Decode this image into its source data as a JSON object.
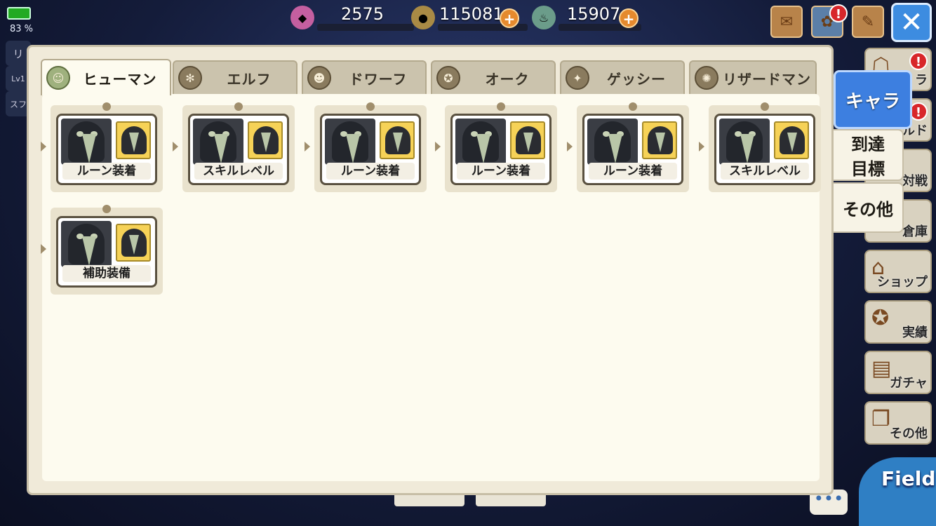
{
  "status": {
    "battery_pct": "83 %"
  },
  "hud_ghost": {
    "name_frag": "リ",
    "lv_frag": "Lv1",
    "sk_frag": "スフ"
  },
  "resources": [
    {
      "name": "crystal",
      "icon": "crystal-icon",
      "value": "2575",
      "has_plus": false
    },
    {
      "name": "gold",
      "icon": "coin-icon",
      "value": "115081",
      "has_plus": true
    },
    {
      "name": "potion",
      "icon": "potion-icon",
      "value": "15907",
      "has_plus": true
    }
  ],
  "top_buttons": [
    "mail-icon",
    "gift-icon",
    "quest-icon"
  ],
  "close_symbol": "✕",
  "tabs": [
    {
      "label": "ヒューマン",
      "active": true,
      "emblem": "☺"
    },
    {
      "label": "エルフ",
      "active": false,
      "emblem": "✻"
    },
    {
      "label": "ドワーフ",
      "active": false,
      "emblem": "☻"
    },
    {
      "label": "オーク",
      "active": false,
      "emblem": "✪"
    },
    {
      "label": "ゲッシー",
      "active": false,
      "emblem": "✦"
    },
    {
      "label": "リザードマン",
      "active": false,
      "emblem": "✺"
    }
  ],
  "nodes": [
    {
      "label": "ルーン装着"
    },
    {
      "label": "スキルレベル"
    },
    {
      "label": "ルーン装着"
    },
    {
      "label": "ルーン装着"
    },
    {
      "label": "ルーン装着"
    },
    {
      "label": "スキルレベル"
    },
    {
      "label": "補助装備"
    }
  ],
  "side_tabs": [
    {
      "label": "キャラ",
      "active": true
    },
    {
      "label": "到達\n目標",
      "active": false
    },
    {
      "label": "その他",
      "active": false
    }
  ],
  "right_menu": [
    {
      "label": "ラ",
      "icon": "character-icon",
      "alert": true
    },
    {
      "label": "ルド",
      "icon": "guild-icon",
      "alert": true
    },
    {
      "label": "対戦",
      "icon": "battle-icon",
      "alert": false
    },
    {
      "label": "倉庫",
      "icon": "storage-icon",
      "alert": false
    },
    {
      "label": "ショップ",
      "icon": "shop-icon",
      "alert": false
    },
    {
      "label": "実績",
      "icon": "achievement-icon",
      "alert": false
    },
    {
      "label": "ガチャ",
      "icon": "gacha-icon",
      "alert": false
    },
    {
      "label": "その他",
      "icon": "other-icon",
      "alert": false
    }
  ],
  "field_label": "Field",
  "chat_symbol": "•••",
  "alert_symbol": "!",
  "plus_symbol": "+"
}
